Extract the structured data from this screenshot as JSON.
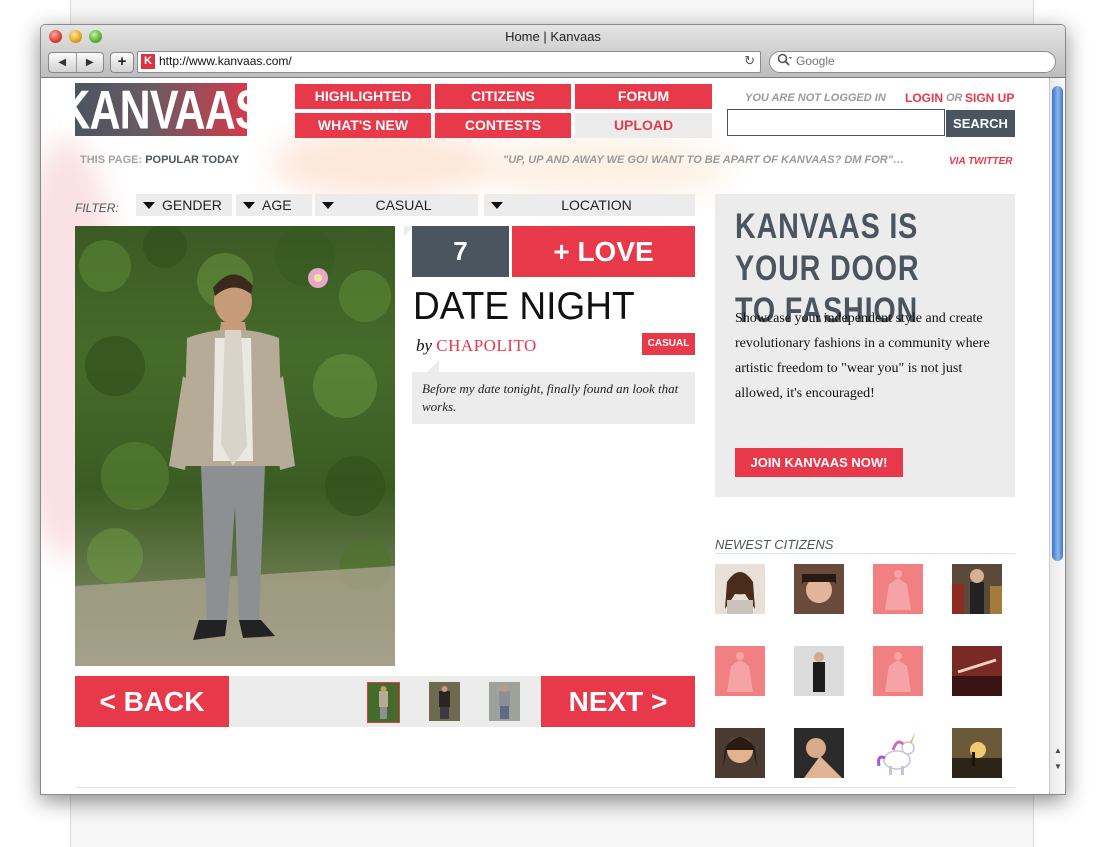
{
  "browser": {
    "window_title": "Home | Kanvaas",
    "nav_back": "◀",
    "nav_forward": "▶",
    "add_bookmark": "+",
    "favicon_letter": "K",
    "url": "http://www.kanvaas.com/",
    "reload_icon": "↻",
    "search_placeholder": "Google"
  },
  "site": {
    "logo": "KANVAAS",
    "nav": {
      "highlighted": "HIGHLIGHTED",
      "citizens": "CITIZENS",
      "forum": "FORUM",
      "whats_new": "WHAT'S NEW",
      "contests": "CONTESTS",
      "upload": "UPLOAD"
    },
    "auth": {
      "not_logged_in": "YOU ARE NOT LOGGED IN",
      "login": "LOGIN",
      "or": "OR",
      "signup": "SIGN UP"
    },
    "search_button": "SEARCH",
    "this_page_label": "THIS PAGE:",
    "this_page_value": "POPULAR TODAY",
    "tweet": "\"UP, UP AND AWAY WE GO! WANT TO BE APART OF KANVAAS? DM FOR\"…",
    "via_twitter": "VIA TWITTER"
  },
  "filter": {
    "label": "FILTER:",
    "gender": "GENDER",
    "age": "AGE",
    "casual": "CASUAL",
    "location": "LOCATION"
  },
  "look": {
    "love_count": "7",
    "love_button": "+ LOVE",
    "title": "DATE NIGHT",
    "by": "by",
    "author": "CHAPOLITO",
    "tag": "CASUAL",
    "description": "Before my date tonight, finally found an look that works."
  },
  "pager": {
    "back": "< BACK",
    "next": "NEXT >"
  },
  "sidebar": {
    "headline": "KANVAAS IS YOUR DOOR TO FASHION",
    "body": "Showcase your independent style and create revolutionary fashions in a community where artistic freedom to \"wear you\" is not just allowed, it's encouraged!",
    "join_button": "JOIN KANVAAS NOW!",
    "newest_title": "NEWEST CITIZENS"
  },
  "colors": {
    "brand_red": "#e8394b",
    "slate": "#4a5560",
    "panel_grey": "#ececec"
  }
}
